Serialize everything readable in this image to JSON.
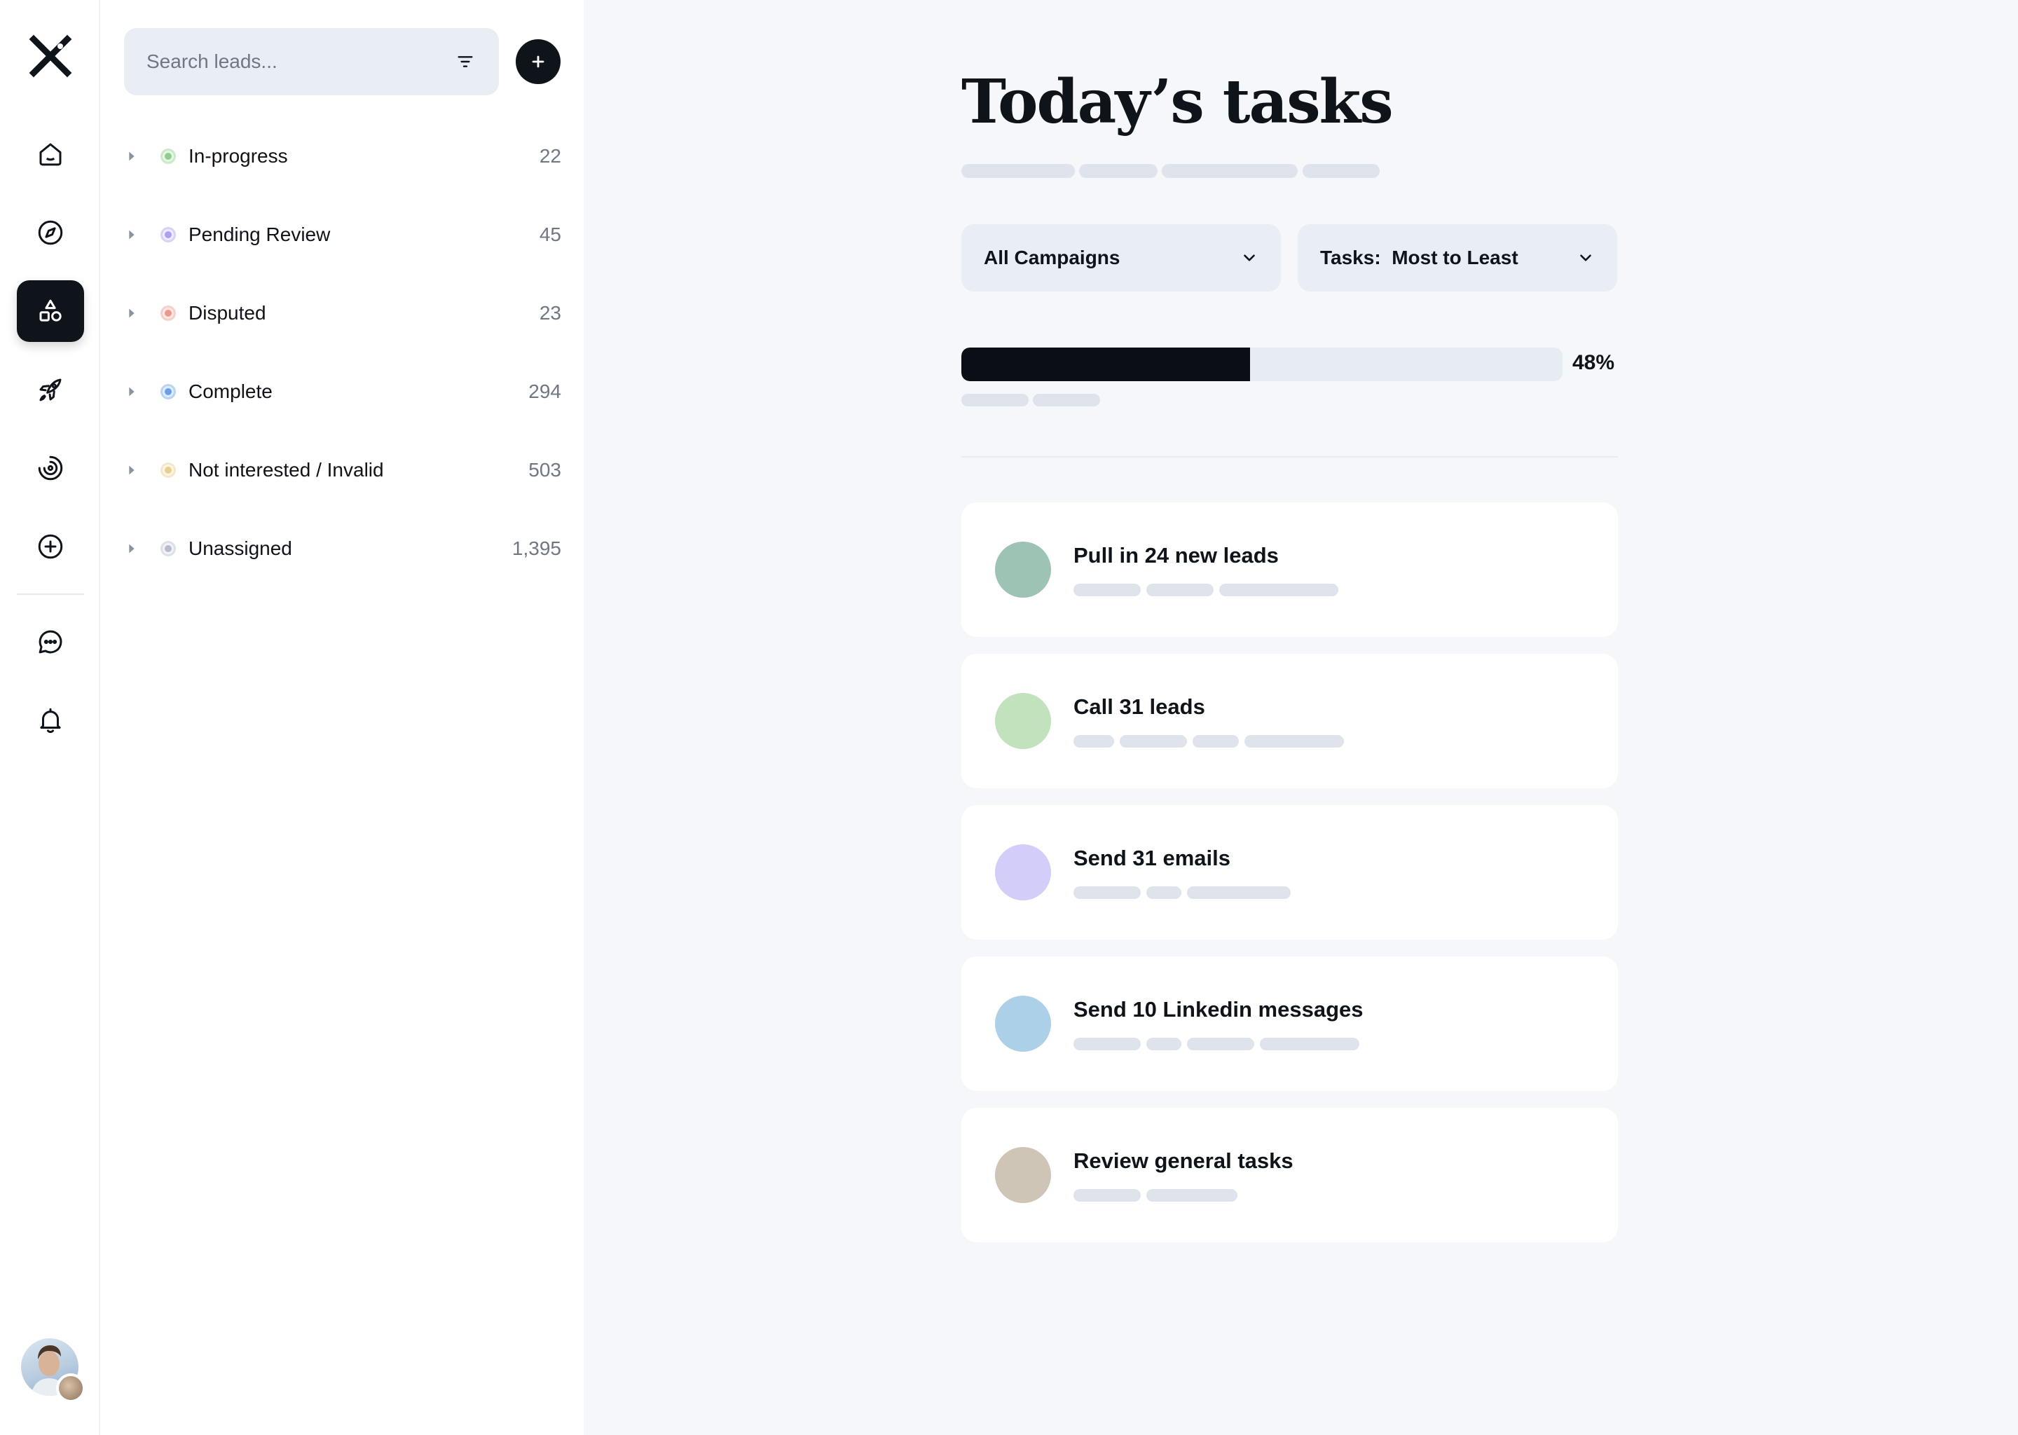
{
  "sidebar_nav": {
    "items": [
      {
        "name": "home-icon",
        "active": false
      },
      {
        "name": "compass-icon",
        "active": false
      },
      {
        "name": "shapes-icon",
        "active": true
      },
      {
        "name": "rocket-icon",
        "active": false
      },
      {
        "name": "target-icon",
        "active": false
      },
      {
        "name": "plus-circle-icon",
        "active": false
      },
      {
        "name": "chat-icon",
        "active": false
      },
      {
        "name": "bell-icon",
        "active": false
      }
    ]
  },
  "leads_panel": {
    "search": {
      "placeholder": "Search leads...",
      "value": ""
    },
    "groups": [
      {
        "label": "In-progress",
        "count": "22",
        "color": "#8fcf8c"
      },
      {
        "label": "Pending Review",
        "count": "45",
        "color": "#a9a0f5"
      },
      {
        "label": "Disputed",
        "count": "23",
        "color": "#f0988a"
      },
      {
        "label": "Complete",
        "count": "294",
        "color": "#6a9ef0"
      },
      {
        "label": "Not interested / Invalid",
        "count": "503",
        "color": "#e8cf8c"
      },
      {
        "label": "Unassigned",
        "count": "1,395",
        "color": "#b5bccb"
      }
    ]
  },
  "main": {
    "title": "Today’s tasks",
    "campaign_filter": {
      "selected": "All Campaigns"
    },
    "sort_filter": {
      "selected": "Tasks:  Most to Least"
    },
    "progress": {
      "value": 0.48,
      "label": "48%"
    },
    "tasks": [
      {
        "label": "Pull in 24 new leads",
        "color": "#9dc3b5"
      },
      {
        "label": "Call 31 leads",
        "color": "#c2e1bd"
      },
      {
        "label": "Send 31 emails",
        "color": "#d3cdf9"
      },
      {
        "label": "Send 10 Linkedin messages",
        "color": "#acd0e8"
      },
      {
        "label": "Review general tasks",
        "color": "#cfc5b6"
      }
    ]
  },
  "colors": {
    "accent": "#0f141b",
    "main_background": "#f6f7fa",
    "skeleton": "#dfe3ec"
  }
}
